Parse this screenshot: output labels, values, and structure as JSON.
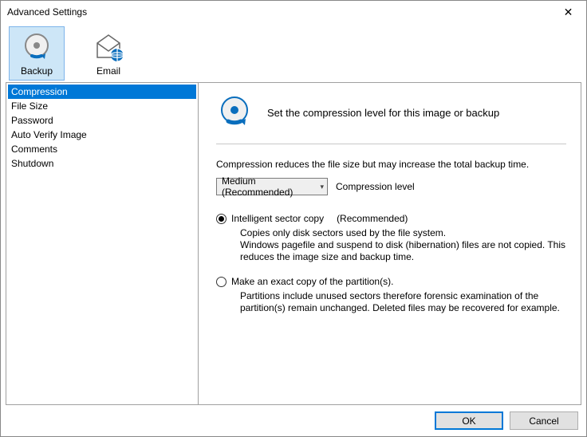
{
  "window": {
    "title": "Advanced Settings"
  },
  "tabs": {
    "backup": "Backup",
    "email": "Email"
  },
  "sidebar": {
    "items": [
      {
        "label": "Compression"
      },
      {
        "label": "File Size"
      },
      {
        "label": "Password"
      },
      {
        "label": "Auto Verify Image"
      },
      {
        "label": "Comments"
      },
      {
        "label": "Shutdown"
      }
    ],
    "selected_index": 0
  },
  "main": {
    "title": "Set the compression level for this image or backup",
    "description": "Compression reduces the file size but may increase the total backup time.",
    "combo_value": "Medium (Recommended)",
    "combo_label": "Compression level",
    "option1": {
      "label": "Intelligent sector copy",
      "rec": "(Recommended)",
      "desc": "Copies only disk sectors used by the file system.\nWindows pagefile and suspend to disk (hibernation) files are not copied. This reduces the image size and backup time."
    },
    "option2": {
      "label": "Make an exact copy of the partition(s).",
      "desc": "Partitions include unused sectors therefore forensic examination of the partition(s) remain unchanged. Deleted files may be recovered for example."
    }
  },
  "footer": {
    "ok": "OK",
    "cancel": "Cancel"
  }
}
